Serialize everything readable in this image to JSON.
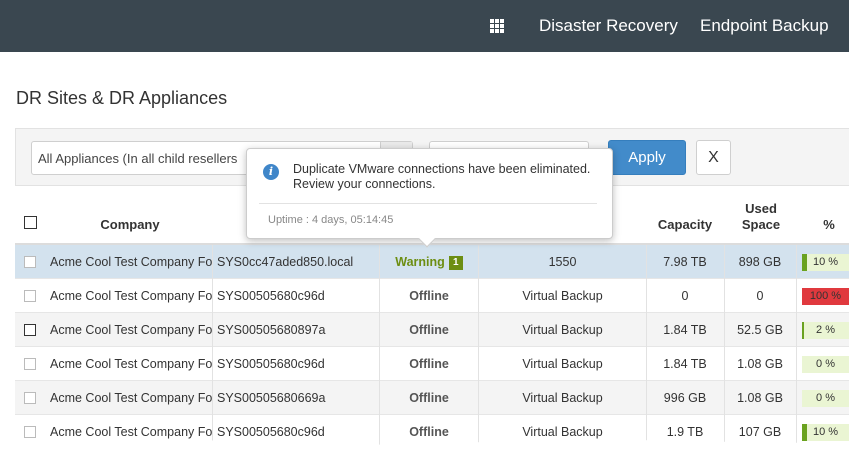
{
  "topbar": {
    "apps_icon": "grid-icon",
    "nav": [
      "Disaster Recovery",
      "Endpoint Backup"
    ]
  },
  "page": {
    "title": "DR Sites & DR Appliances"
  },
  "filters": {
    "appliance_select": "All Appliances (In all child resellers",
    "apply_label": "Apply",
    "clear_label": "X"
  },
  "table": {
    "headers": {
      "company": "Company",
      "capacity": "Capacity",
      "used_space_1": "Used",
      "used_space_2": "Space",
      "percent": "%"
    },
    "rows": [
      {
        "company": "Acme Cool Test Company For",
        "system": "SYS0cc47aded850.local",
        "status": "Warning",
        "status_badge": "1",
        "type": "1550",
        "capacity": "7.98 TB",
        "used": "898 GB",
        "percent": "10 %",
        "percent_value": 10
      },
      {
        "company": "Acme Cool Test Company For",
        "system": "SYS00505680c96d",
        "status": "Offline",
        "type": "Virtual Backup",
        "capacity": "0",
        "used": "0",
        "percent": "100 %",
        "percent_value": 100
      },
      {
        "company": "Acme Cool Test Company For",
        "system": "SYS00505680897a",
        "status": "Offline",
        "type": "Virtual Backup",
        "capacity": "1.84 TB",
        "used": "52.5 GB",
        "percent": "2 %",
        "percent_value": 2
      },
      {
        "company": "Acme Cool Test Company For",
        "system": "SYS00505680c96d",
        "status": "Offline",
        "type": "Virtual Backup",
        "capacity": "1.84 TB",
        "used": "1.08 GB",
        "percent": "0 %",
        "percent_value": 0
      },
      {
        "company": "Acme Cool Test Company For",
        "system": "SYS00505680669a",
        "status": "Offline",
        "type": "Virtual Backup",
        "capacity": "996 GB",
        "used": "1.08 GB",
        "percent": "0 %",
        "percent_value": 0
      },
      {
        "company": "Acme Cool Test Company For",
        "system": "SYS00505680c96d",
        "status": "Offline",
        "type": "Virtual Backup",
        "capacity": "1.9 TB",
        "used": "107 GB",
        "percent": "10 %",
        "percent_value": 10
      }
    ]
  },
  "tooltip": {
    "icon": "info-icon",
    "message_line1": "Duplicate VMware connections have been eliminated.",
    "message_line2": "Review your connections.",
    "uptime": "Uptime : 4 days, 05:14:45"
  },
  "colors": {
    "topbar": "#3a4750",
    "primary": "#428bca",
    "warning": "#6d8e12",
    "usage_fill": "#6aa21f",
    "usage_full": "#e0393e"
  }
}
